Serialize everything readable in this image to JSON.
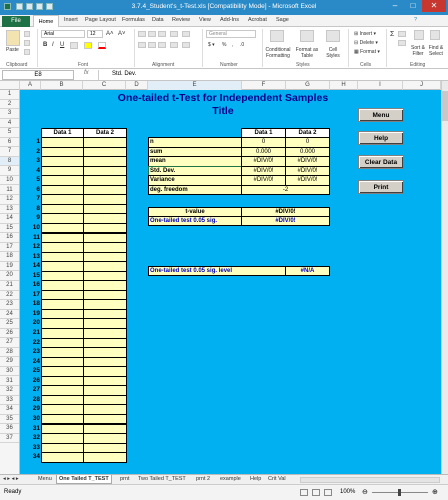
{
  "window": {
    "title": "3.7.4_Student's_t-Test.xls [Compatibility Mode] - Microsoft Excel"
  },
  "ribbon_tabs": [
    "File",
    "Home",
    "Insert",
    "Page Layout",
    "Formulas",
    "Data",
    "Review",
    "View",
    "Add-Ins",
    "Acrobat",
    "Sage"
  ],
  "ribbon": {
    "clipboard": {
      "paste": "Paste",
      "group": "Clipboard"
    },
    "font": {
      "name": "Arial",
      "size": "12",
      "bold": "B",
      "italic": "I",
      "underline": "U",
      "group": "Font"
    },
    "alignment": {
      "group": "Alignment"
    },
    "number": {
      "format": "General",
      "group": "Number"
    },
    "styles": {
      "conditional": "Conditional Formatting",
      "format_table": "Format as Table",
      "cell_styles": "Cell Styles",
      "group": "Styles"
    },
    "cells": {
      "insert": "Insert",
      "delete": "Delete",
      "format": "Format",
      "group": "Cells"
    },
    "editing": {
      "sort": "Sort & Filter",
      "find": "Find & Select",
      "group": "Editing"
    }
  },
  "formula_bar": {
    "name_box": "E8",
    "fx": "fx",
    "content": "Std. Dev."
  },
  "columns": [
    "A",
    "B",
    "C",
    "D",
    "E",
    "F",
    "G",
    "H",
    "I",
    "J"
  ],
  "rows": [
    "1",
    "2",
    "3",
    "4",
    "5",
    "6",
    "7",
    "8",
    "9",
    "10",
    "11",
    "12",
    "13",
    "14",
    "15",
    "16",
    "17",
    "18",
    "19",
    "20",
    "21",
    "22",
    "23",
    "24",
    "25",
    "26",
    "27",
    "28",
    "29",
    "30",
    "31",
    "32",
    "33",
    "34",
    "35",
    "36",
    "37"
  ],
  "sheet": {
    "title": "One-tailed t-Test for Independent Samples",
    "subtitle": "Title",
    "data1_header": "Data 1",
    "data2_header": "Data 2",
    "index_numbers": [
      "1",
      "2",
      "3",
      "4",
      "5",
      "6",
      "7",
      "8",
      "9",
      "10",
      "11",
      "12",
      "13",
      "14",
      "15",
      "16",
      "17",
      "18",
      "19",
      "20",
      "21",
      "22",
      "23",
      "24",
      "25",
      "26",
      "27",
      "28",
      "29",
      "30",
      "31",
      "32",
      "33",
      "34"
    ],
    "stats_headers": [
      "Data 1",
      "Data 2"
    ],
    "stats": [
      {
        "label": "n",
        "d1": "0",
        "d2": "0"
      },
      {
        "label": "sum",
        "d1": "0.000",
        "d2": "0.000"
      },
      {
        "label": "mean",
        "d1": "#DIV/0!",
        "d2": "#DIV/0!"
      },
      {
        "label": "Std. Dev.",
        "d1": "#DIV/0!",
        "d2": "#DIV/0!"
      },
      {
        "label": "Variance",
        "d1": "#DIV/0!",
        "d2": "#DIV/0!"
      },
      {
        "label": "deg. freedom",
        "d1": "-2",
        "d2": ""
      }
    ],
    "tvalue_label": "t-value",
    "tvalue": "#DIV/0!",
    "onetail_sig_label": "One-tailed test 0.05 sig.",
    "onetail_sig": "#DIV/0!",
    "onetail_level_label": "One-tailed test 0.05 sig. level",
    "onetail_level": "#N/A"
  },
  "buttons": [
    "Menu",
    "Help",
    "Clear Data",
    "Print"
  ],
  "sheet_tabs": [
    "Menu",
    "One Tailed T_TEST",
    "prnt",
    "Two Tailed T_TEST",
    "prnt 2",
    "example",
    "Help",
    "Crit Val"
  ],
  "status": {
    "ready": "Ready",
    "zoom": "100%"
  },
  "colors": {
    "sheet_bg": "#00b0f0",
    "cell_fill": "#ffffc0",
    "title_blue": "#00008b",
    "excel_green": "#1e7145",
    "titlebar": "#2a8ac7"
  }
}
